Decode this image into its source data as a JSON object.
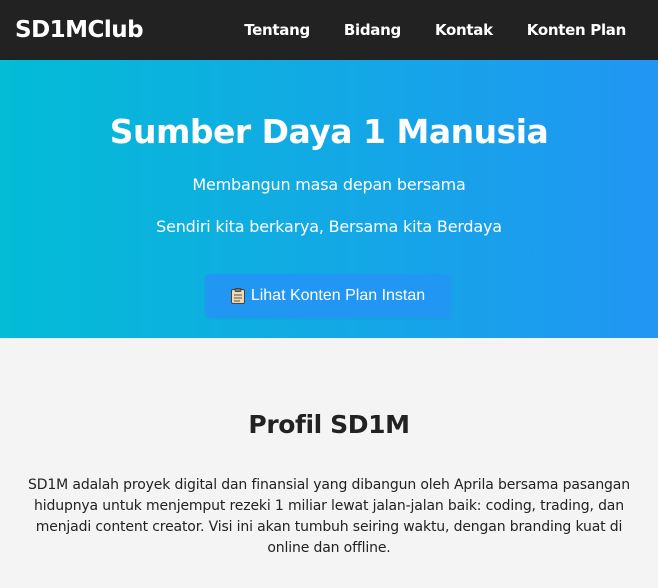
{
  "navbar": {
    "brand": "SD1MClub",
    "links": [
      {
        "label": "Tentang"
      },
      {
        "label": "Bidang"
      },
      {
        "label": "Kontak"
      },
      {
        "label": "Konten Plan"
      }
    ]
  },
  "hero": {
    "title": "Sumber Daya 1 Manusia",
    "subtitle": "Membangun masa depan bersama",
    "tagline": "Sendiri kita berkarya, Bersama kita Berdaya",
    "cta": {
      "icon": "clipboard-icon",
      "label": "Lihat Konten Plan Instan"
    }
  },
  "profile": {
    "title": "Profil SD1M",
    "body": "SD1M adalah proyek digital dan finansial yang dibangun oleh Aprila bersama pasangan hidupnya untuk menjemput rezeki 1 miliar lewat jalan-jalan baik: coding, trading, dan menjadi content creator. Visi ini akan tumbuh seiring waktu, dengan branding kuat di online dan offline."
  },
  "colors": {
    "navbar_bg": "#222222",
    "hero_gradient_start": "#03bcd6",
    "hero_gradient_end": "#2196f3",
    "cta_bg": "#2196f3",
    "section_bg": "#f4f4f4"
  }
}
